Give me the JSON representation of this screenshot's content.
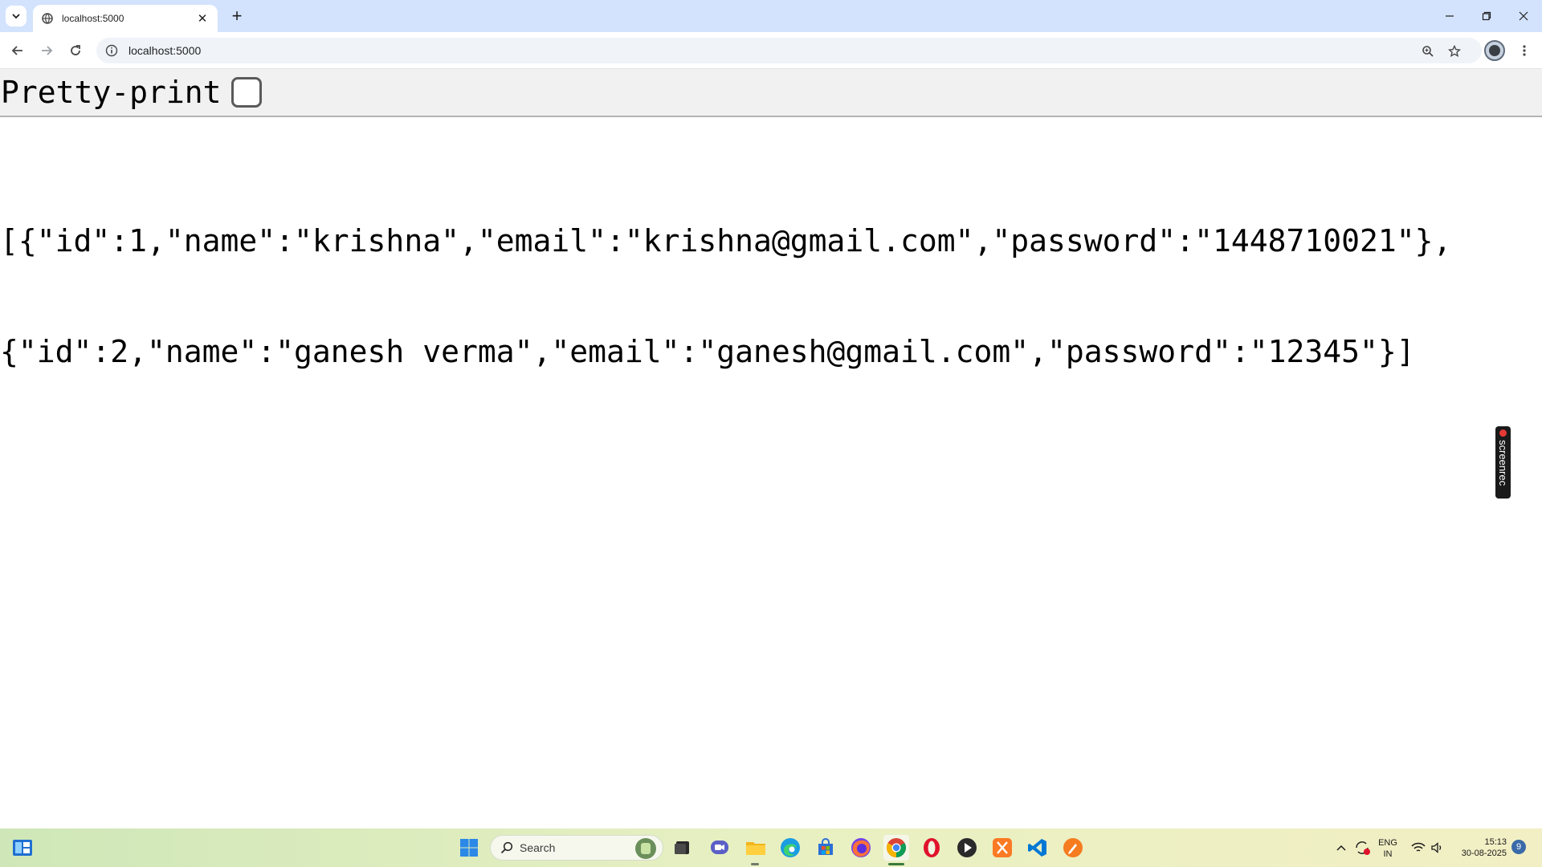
{
  "browser": {
    "tab_title": "localhost:5000",
    "url": "localhost:5000"
  },
  "viewer": {
    "pretty_print_label": "Pretty-print",
    "pretty_print_checked": false,
    "json_line_1": "[{\"id\":1,\"name\":\"krishna\",\"email\":\"krishna@gmail.com\",\"password\":\"1448710021\"},",
    "json_line_2": "{\"id\":2,\"name\":\"ganesh verma\",\"email\":\"ganesh@gmail.com\",\"password\":\"12345\"}]"
  },
  "overlay": {
    "screenrec_label": "screenrec"
  },
  "taskbar": {
    "search_label": "Search",
    "lang_top": "ENG",
    "lang_bottom": "IN",
    "time": "15:13",
    "date": "30-08-2025",
    "notification_count": "9"
  },
  "colors": {
    "tabstrip_bg": "#d3e3fd",
    "omnibox_bg": "#f0f4f9",
    "viewer_bar_bg": "#f1f1f1"
  }
}
